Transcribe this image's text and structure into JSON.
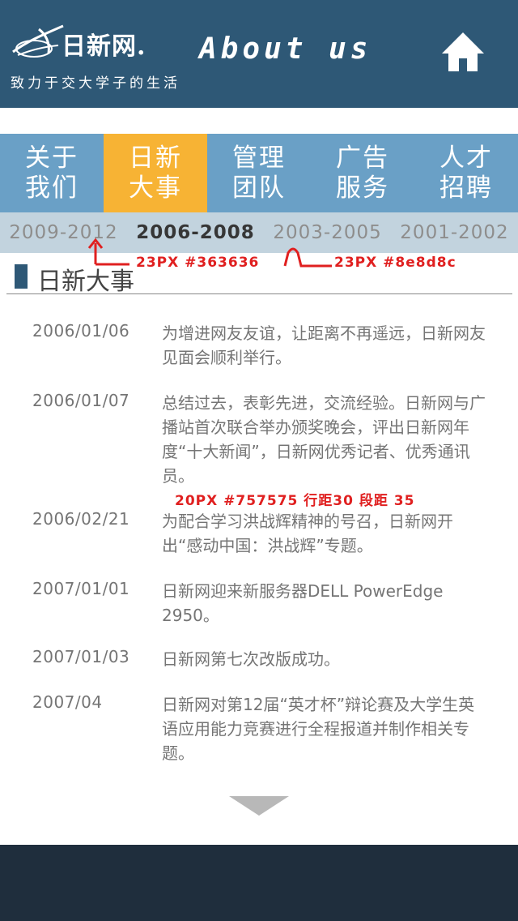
{
  "header": {
    "logo_text": "日新网.",
    "slogan": "致力于交大学子的生活",
    "title": "About us",
    "home_icon": "home-icon"
  },
  "nav": {
    "items": [
      {
        "label": "关于我们",
        "active": false
      },
      {
        "label": "日新大事",
        "active": true
      },
      {
        "label": "管理团队",
        "active": false
      },
      {
        "label": "广告服务",
        "active": false
      },
      {
        "label": "人才招聘",
        "active": false
      }
    ]
  },
  "years": {
    "items": [
      {
        "label": "2009-2012",
        "active": false
      },
      {
        "label": "2006-2008",
        "active": true
      },
      {
        "label": "2003-2005",
        "active": false
      },
      {
        "label": "2001-2002",
        "active": false
      }
    ]
  },
  "section": {
    "title": "日新大事"
  },
  "events": [
    {
      "date": "2006/01/06",
      "text": "为增进网友友谊，让距离不再遥远，日新网友见面会顺利举行。"
    },
    {
      "date": "2006/01/07",
      "text": "总结过去，表彰先进，交流经验。日新网与广播站首次联合举办颁奖晚会，评出日新网年度“十大新闻”，日新网优秀记者、优秀通讯员。"
    },
    {
      "date": "2006/02/21",
      "text": "为配合学习洪战辉精神的号召，日新网开出“感动中国：洪战辉”专题。"
    },
    {
      "date": "2007/01/01",
      "text": "日新网迎来新服务器DELL PowerEdge 2950。"
    },
    {
      "date": "2007/01/03",
      "text": "日新网第七次改版成功。"
    },
    {
      "date": "2007/04",
      "text": "日新网对第12届“英才杯”辩论赛及大学生英语应用能力竞赛进行全程报道并制作相关专题。"
    }
  ],
  "annotations": {
    "active_year_spec": "23PX  #363636",
    "inactive_year_spec": "23PX  #8e8d8c",
    "body_spec": "20PX #757575    行距30     段距 35"
  },
  "colors": {
    "header_bg": "#2e5876",
    "nav_bg": "#6aa0c6",
    "nav_active": "#f7b334",
    "years_bg": "#c2d3de",
    "year_active": "#363636",
    "year_inactive": "#8e8d8c",
    "body_text": "#757575",
    "annotation": "#e02020",
    "footer_bg": "#1f2e3d"
  },
  "more_icon": "chevron-down-icon"
}
